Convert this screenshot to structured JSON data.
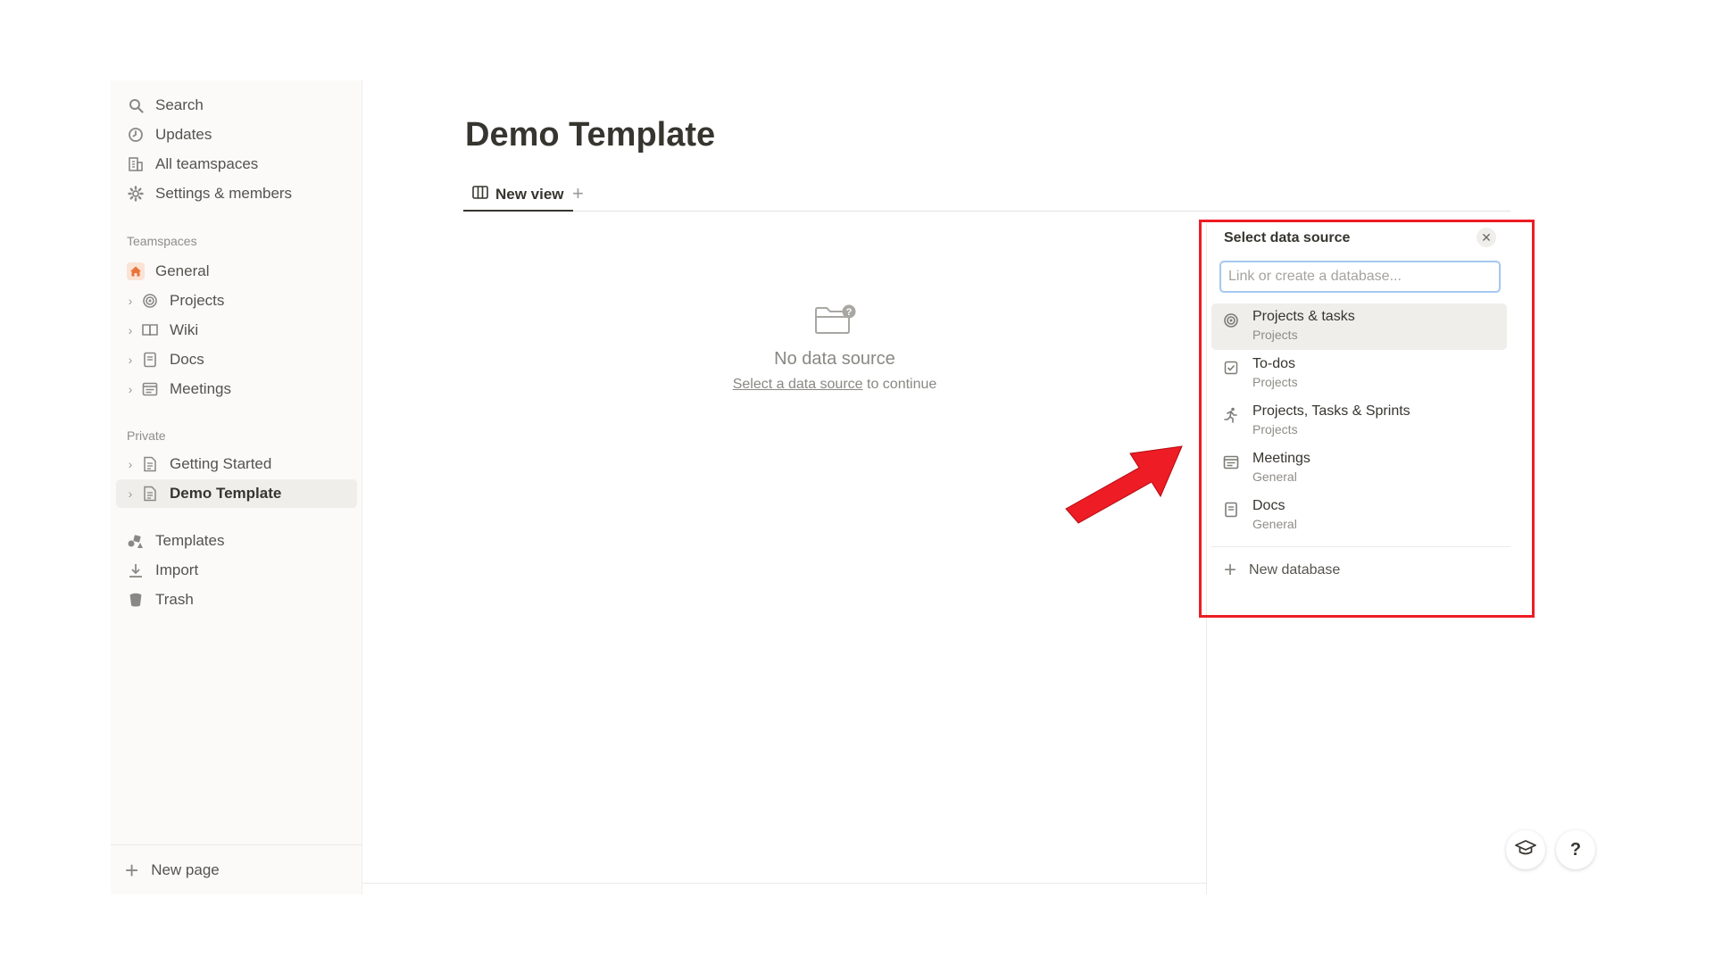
{
  "sidebar": {
    "top_items": [
      {
        "label": "Search",
        "icon": "search-icon"
      },
      {
        "label": "Updates",
        "icon": "clock-icon"
      },
      {
        "label": "All teamspaces",
        "icon": "building-icon"
      },
      {
        "label": "Settings & members",
        "icon": "gear-icon"
      }
    ],
    "teamspaces_heading": "Teamspaces",
    "teamspaces": [
      {
        "label": "General",
        "icon": "home-icon"
      },
      {
        "label": "Projects",
        "icon": "target-icon"
      },
      {
        "label": "Wiki",
        "icon": "book-icon"
      },
      {
        "label": "Docs",
        "icon": "document-icon"
      },
      {
        "label": "Meetings",
        "icon": "calendar-icon"
      }
    ],
    "private_heading": "Private",
    "private": [
      {
        "label": "Getting Started",
        "icon": "page-icon"
      },
      {
        "label": "Demo Template",
        "icon": "page-icon",
        "active": true
      }
    ],
    "bottom_items": [
      {
        "label": "Templates",
        "icon": "templates-icon"
      },
      {
        "label": "Import",
        "icon": "download-icon"
      },
      {
        "label": "Trash",
        "icon": "trash-icon"
      }
    ],
    "new_page": "New page"
  },
  "main": {
    "title": "Demo Template",
    "tab_label": "New view",
    "empty_title": "No data source",
    "empty_link": "Select a data source",
    "empty_suffix": " to continue"
  },
  "panel": {
    "title": "Select data source",
    "placeholder": "Link or create a database...",
    "items": [
      {
        "name": "Projects & tasks",
        "sub": "Projects",
        "icon": "target-icon"
      },
      {
        "name": "To-dos",
        "sub": "Projects",
        "icon": "checkbox-icon"
      },
      {
        "name": "Projects, Tasks & Sprints",
        "sub": "Projects",
        "icon": "runner-icon"
      },
      {
        "name": "Meetings",
        "sub": "General",
        "icon": "calendar-icon"
      },
      {
        "name": "Docs",
        "sub": "General",
        "icon": "document-icon"
      }
    ],
    "new_database": "New database"
  },
  "colors": {
    "highlight": "#ee1c24",
    "arrow": "#ee1c24",
    "input_focus": "#a4c8ee",
    "general_icon": "#e9733a"
  }
}
